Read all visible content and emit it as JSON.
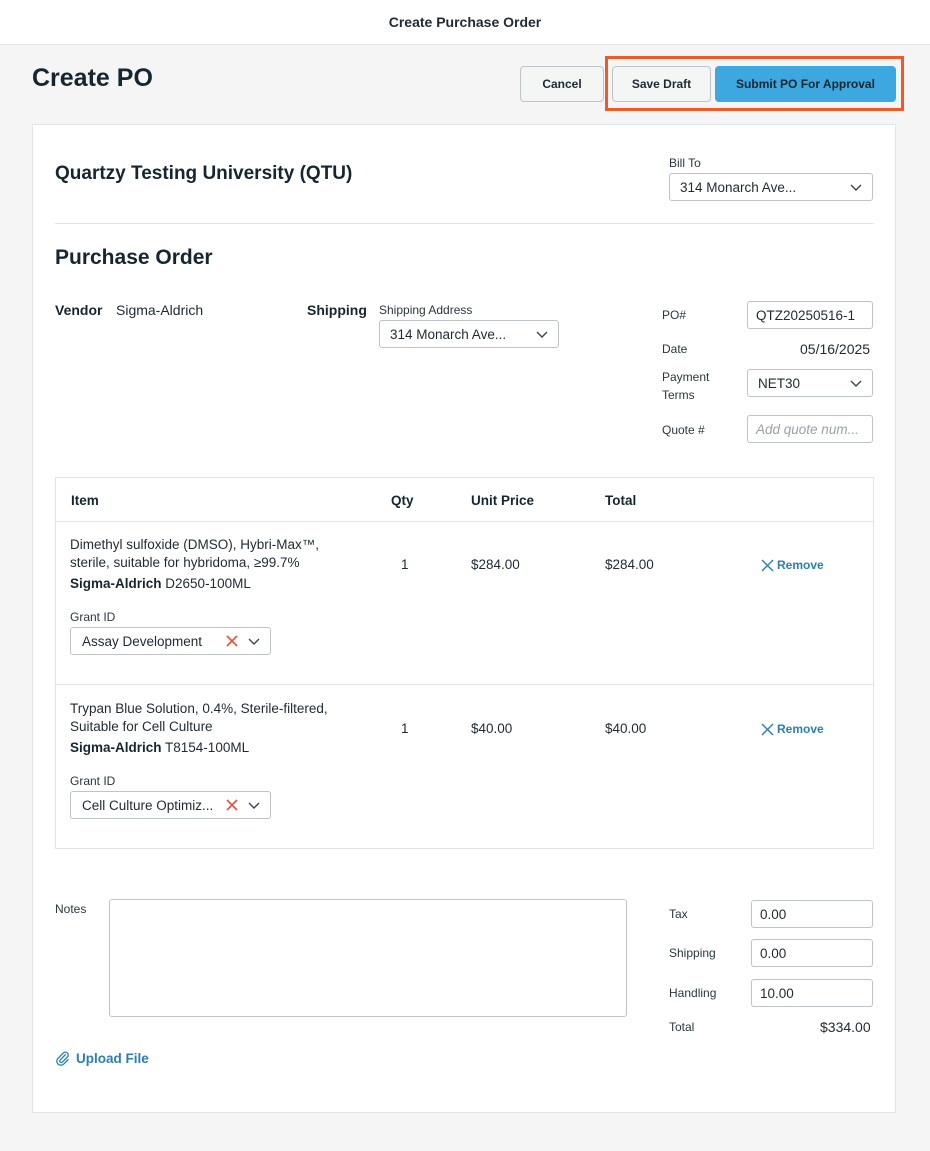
{
  "topbar": {
    "title": "Create Purchase Order"
  },
  "page": {
    "title": "Create PO"
  },
  "actions": {
    "cancel": "Cancel",
    "save_draft": "Save Draft",
    "submit": "Submit PO For Approval"
  },
  "org": {
    "name": "Quartzy Testing University (QTU)"
  },
  "bill_to": {
    "label": "Bill To",
    "value": "314 Monarch Ave..."
  },
  "purchase_order": {
    "title": "Purchase Order",
    "vendor_label": "Vendor",
    "vendor": "Sigma-Aldrich",
    "shipping_label": "Shipping",
    "shipping_address_label": "Shipping Address",
    "shipping_address": "314 Monarch Ave...",
    "po_label": "PO#",
    "po_number": "QTZ20250516-1",
    "date_label": "Date",
    "date": "05/16/2025",
    "payment_label_1": "Payment",
    "payment_label_2": "Terms",
    "payment_terms": "NET30",
    "quote_label": "Quote #",
    "quote_placeholder": "Add quote num..."
  },
  "table": {
    "headers": {
      "item": "Item",
      "qty": "Qty",
      "unit_price": "Unit Price",
      "total": "Total"
    },
    "rows": [
      {
        "name_line1": "Dimethyl sulfoxide (DMSO), Hybri-Max™,",
        "name_line2": "sterile, suitable for hybridoma, ≥99.7%",
        "vendor": "Sigma-Aldrich",
        "catalog": "D2650-100ML",
        "qty": "1",
        "unit_price": "$284.00",
        "total": "$284.00",
        "remove": "Remove",
        "grant_label": "Grant ID",
        "grant": "Assay Development"
      },
      {
        "name_line1": "Trypan Blue Solution, 0.4%, Sterile-filtered,",
        "name_line2": "Suitable for Cell Culture",
        "vendor": "Sigma-Aldrich",
        "catalog": "T8154-100ML",
        "qty": "1",
        "unit_price": "$40.00",
        "total": "$40.00",
        "remove": "Remove",
        "grant_label": "Grant ID",
        "grant": "Cell Culture Optimiz..."
      }
    ]
  },
  "notes": {
    "label": "Notes",
    "value": ""
  },
  "upload": {
    "label": "Upload File"
  },
  "summary": {
    "tax_label": "Tax",
    "tax": "0.00",
    "shipping_label": "Shipping",
    "shipping": "0.00",
    "handling_label": "Handling",
    "handling": "10.00",
    "total_label": "Total",
    "total": "$334.00"
  },
  "colors": {
    "primary": "#3da8e0",
    "highlight": "#f05a28",
    "link": "#2b7fb0",
    "danger": "#e2533a"
  }
}
